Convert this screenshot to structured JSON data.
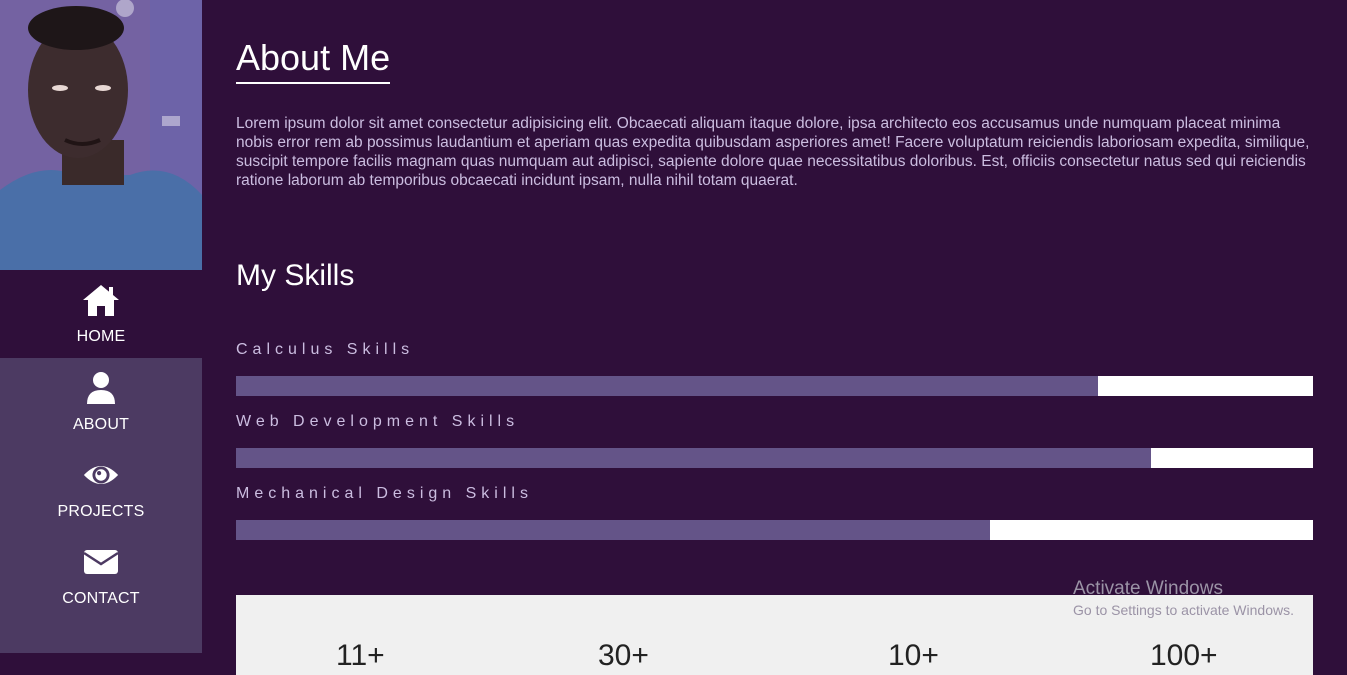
{
  "sidebar": {
    "nav": [
      {
        "label": "HOME",
        "icon": "home-icon",
        "active": true
      },
      {
        "label": "ABOUT",
        "icon": "user-icon",
        "active": false
      },
      {
        "label": "PROJECTS",
        "icon": "eye-icon",
        "active": false
      },
      {
        "label": "CONTACT",
        "icon": "envelope-icon",
        "active": false
      }
    ]
  },
  "about": {
    "title": "About Me",
    "text": "Lorem ipsum dolor sit amet consectetur adipisicing elit. Obcaecati aliquam itaque dolore, ipsa architecto eos accusamus unde numquam placeat minima nobis error rem ab possimus laudantium et aperiam quas expedita quibusdam asperiores amet! Facere voluptatum reiciendis laboriosam expedita, similique, suscipit tempore facilis magnam quas numquam aut adipisci, sapiente dolore quae necessitatibus doloribus. Est, officiis consectetur natus sed qui reiciendis ratione laborum ab temporibus obcaecati incidunt ipsam, nulla nihil totam quaerat."
  },
  "skills": {
    "title": "My Skills",
    "items": [
      {
        "label": "Calculus Skills",
        "level": 0.8
      },
      {
        "label": "Web Development Skills",
        "level": 0.85
      },
      {
        "label": "Mechanical Design Skills",
        "level": 0.7
      }
    ]
  },
  "stats": {
    "values": [
      "11+",
      "30+",
      "10+",
      "100+"
    ]
  },
  "watermark": {
    "title": "Activate Windows",
    "subtitle": "Go to Settings to activate Windows."
  },
  "colors": {
    "background": "#2f0f3a",
    "sidebar": "#4c3a62",
    "bar_fill": "#645488",
    "bar_track": "#ffffff"
  }
}
